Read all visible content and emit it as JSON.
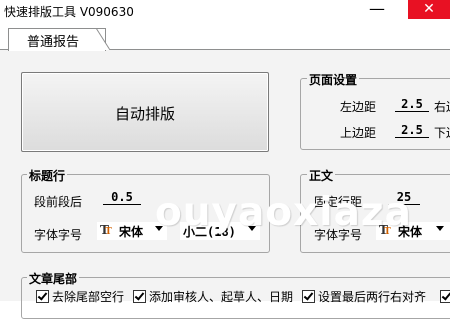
{
  "window": {
    "title": "快速排版工具 V090630",
    "minimize_glyph": "—",
    "close_glyph": "✕"
  },
  "tabs": [
    {
      "label": "普通报告",
      "selected": true
    }
  ],
  "actions": {
    "auto_format_label": "自动排版"
  },
  "page_settings": {
    "legend": "页面设置",
    "left_margin_label": "左边距",
    "left_margin_value": "2.5",
    "right_margin_label": "右边",
    "top_margin_label": "上边距",
    "top_margin_value": "2.5",
    "bottom_margin_label": "下边"
  },
  "heading": {
    "legend": "标题行",
    "spacing_label": "段前段后",
    "spacing_value": "0.5",
    "font_label": "字体字号",
    "font_name": "宋体",
    "font_size": "小二(18)"
  },
  "body_text": {
    "legend": "正文",
    "line_spacing_label": "固定行距",
    "line_spacing_value": "25",
    "font_label": "字体字号",
    "font_name": "宋体"
  },
  "ending": {
    "legend": "文章尾部",
    "options": [
      {
        "label": "去除尾部空行",
        "checked": true
      },
      {
        "label": "添加审核人、起草人、日期",
        "checked": true
      },
      {
        "label": "设置最后两行右对齐",
        "checked": true
      }
    ]
  },
  "watermark": "ouyaoxiaza",
  "colors": {
    "close_button": "#e81123",
    "panel_background": "#f3f3f3",
    "border": "#a6a6a6"
  }
}
